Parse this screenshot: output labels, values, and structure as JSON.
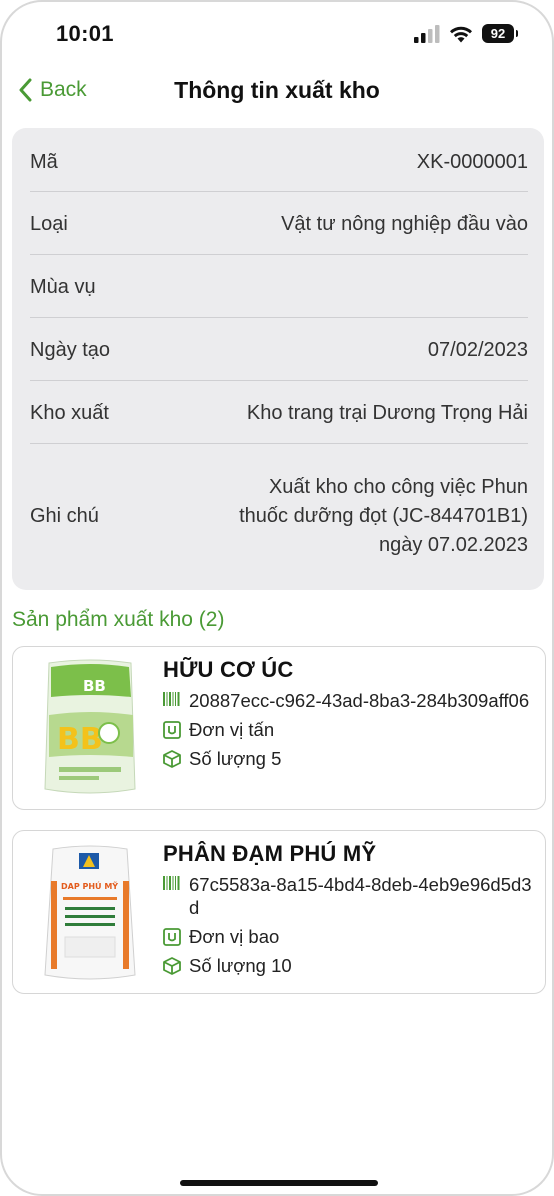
{
  "status_bar": {
    "time": "10:01",
    "battery": "92"
  },
  "nav": {
    "back_label": "Back",
    "title": "Thông tin xuất kho"
  },
  "info": {
    "code_label": "Mã",
    "code_value": "XK-0000001",
    "type_label": "Loại",
    "type_value": "Vật tư nông nghiệp đầu vào",
    "season_label": "Mùa vụ",
    "season_value": "",
    "created_label": "Ngày tạo",
    "created_value": "07/02/2023",
    "warehouse_label": "Kho xuất",
    "warehouse_value": "Kho trang trại Dương Trọng Hải",
    "note_label": "Ghi chú",
    "note_value": "Xuất kho cho công việc Phun thuốc dưỡng đọt (JC-844701B1) ngày 07.02.2023"
  },
  "products_section": {
    "title": "Sản phẩm xuất kho (2)"
  },
  "products": [
    {
      "name": "HỮU CƠ ÚC",
      "code": "20887ecc-c962-43ad-8ba3-284b309aff06",
      "unit": "Đơn vị tấn",
      "quantity": "Số lượng 5",
      "bag_brand": "BB"
    },
    {
      "name": "PHÂN ĐẠM PHÚ MỸ",
      "code": "67c5583a-8a15-4bd4-8deb-4eb9e96d5d3d",
      "unit": "Đơn vị bao",
      "quantity": "Số lượng 10",
      "bag_brand": "DAP PHÚ MỸ"
    }
  ],
  "colors": {
    "accent": "#4a9a35",
    "card_bg": "#ececee"
  },
  "icons": [
    "back-chevron-icon",
    "signal-icon",
    "wifi-icon",
    "battery-icon",
    "barcode-icon",
    "unit-icon",
    "box-icon"
  ]
}
